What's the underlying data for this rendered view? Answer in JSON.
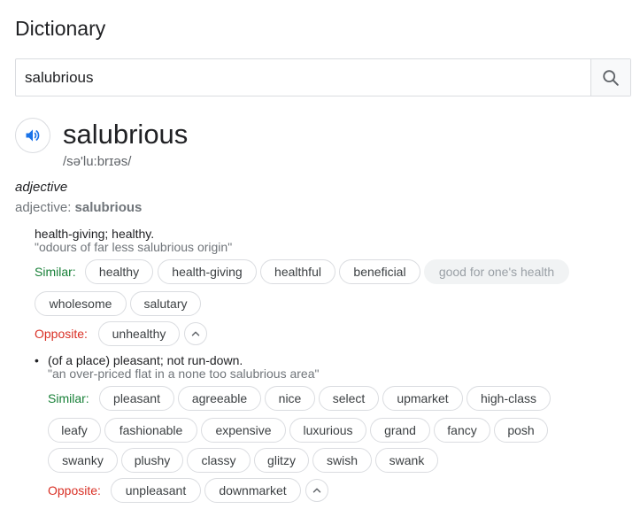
{
  "title": "Dictionary",
  "search": {
    "value": "salubrious"
  },
  "entry": {
    "word": "salubrious",
    "phonetic": "/sə'lu:brɪəs/",
    "part_of_speech": "adjective",
    "form_label": "adjective:",
    "form_word": "salubrious"
  },
  "sense1": {
    "definition": "health-giving; healthy.",
    "example": "\"odours of far less salubrious origin\"",
    "similar_label": "Similar:",
    "similar": [
      "healthy",
      "health-giving",
      "healthful",
      "beneficial",
      "good for one's health",
      "wholesome",
      "salutary"
    ],
    "opposite_label": "Opposite:",
    "opposite": [
      "unhealthy"
    ]
  },
  "sense2": {
    "bullet": "•",
    "definition": "(of a place) pleasant; not run-down.",
    "example": "\"an over-priced flat in a none too salubrious area\"",
    "similar_label": "Similar:",
    "similar": [
      "pleasant",
      "agreeable",
      "nice",
      "select",
      "upmarket",
      "high-class",
      "leafy",
      "fashionable",
      "expensive",
      "luxurious",
      "grand",
      "fancy",
      "posh",
      "swanky",
      "plushy",
      "classy",
      "glitzy",
      "swish",
      "swank"
    ],
    "opposite_label": "Opposite:",
    "opposite": [
      "unpleasant",
      "downmarket"
    ]
  },
  "icons": {
    "search": "search-icon",
    "speaker": "speaker-icon",
    "collapse": "chevron-up-icon"
  }
}
